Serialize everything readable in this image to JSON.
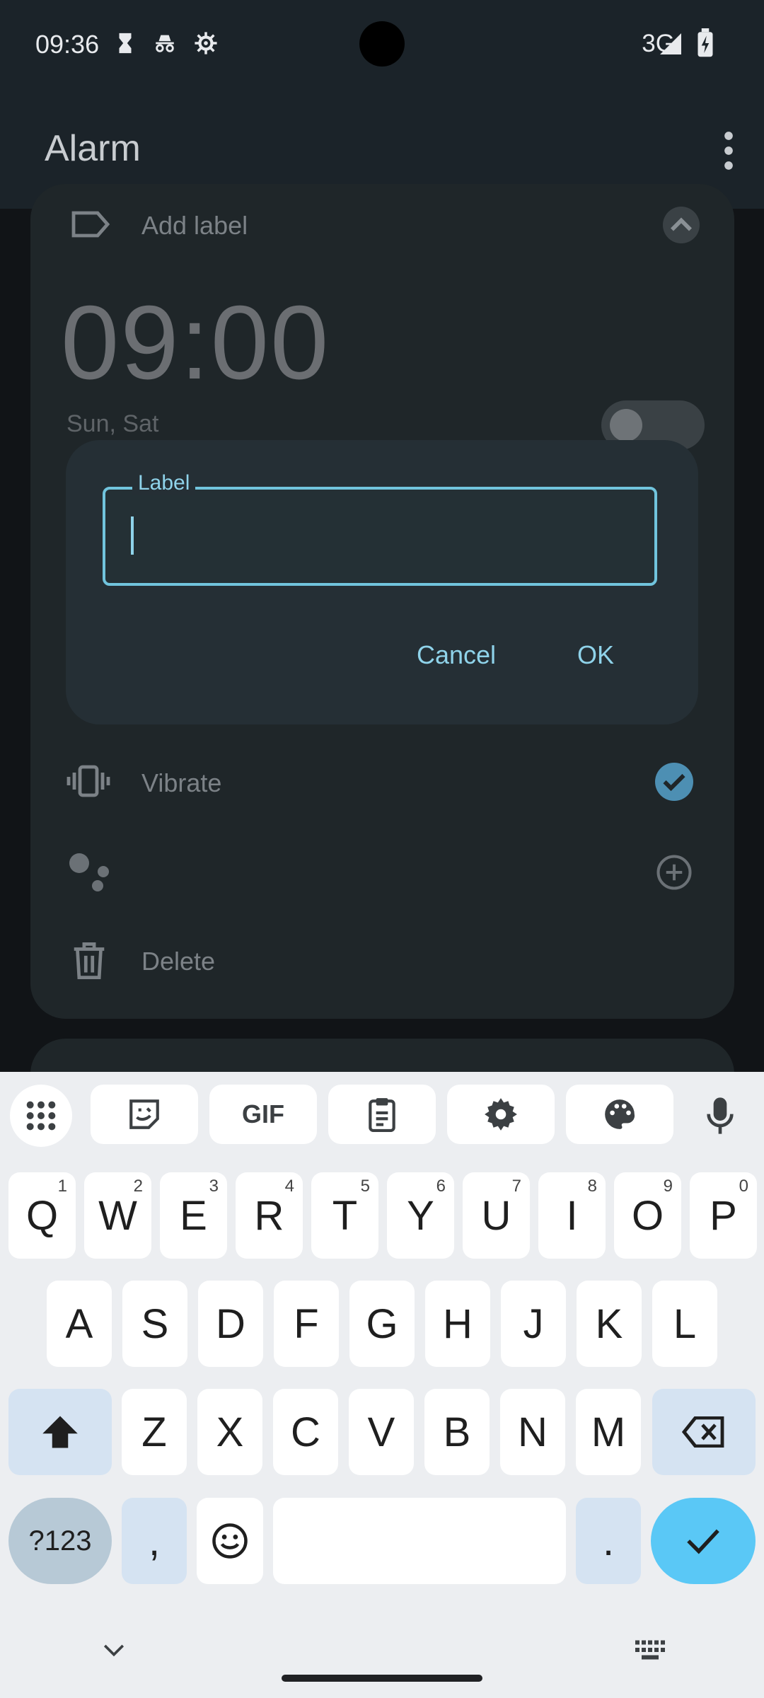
{
  "status_bar": {
    "time": "09:36",
    "network": "3G"
  },
  "app_bar": {
    "title": "Alarm"
  },
  "alarm": {
    "add_label": "Add label",
    "time": "09:00",
    "days": "Sun, Sat",
    "vibrate": "Vibrate",
    "delete": "Delete"
  },
  "dialog": {
    "field_label": "Label",
    "field_value": "",
    "cancel": "Cancel",
    "ok": "OK"
  },
  "keyboard": {
    "toolbar": [
      "apps-icon",
      "sticker-icon",
      "GIF",
      "clipboard-icon",
      "settings-icon",
      "palette-icon",
      "mic-icon"
    ],
    "row1": [
      {
        "key": "Q",
        "num": "1"
      },
      {
        "key": "W",
        "num": "2"
      },
      {
        "key": "E",
        "num": "3"
      },
      {
        "key": "R",
        "num": "4"
      },
      {
        "key": "T",
        "num": "5"
      },
      {
        "key": "Y",
        "num": "6"
      },
      {
        "key": "U",
        "num": "7"
      },
      {
        "key": "I",
        "num": "8"
      },
      {
        "key": "O",
        "num": "9"
      },
      {
        "key": "P",
        "num": "0"
      }
    ],
    "row2": [
      "A",
      "S",
      "D",
      "F",
      "G",
      "H",
      "J",
      "K",
      "L"
    ],
    "row3": [
      "Z",
      "X",
      "C",
      "V",
      "B",
      "N",
      "M"
    ],
    "symbols": "?123",
    "comma": ",",
    "period": ".",
    "accent_color": "#5ac8f6"
  }
}
